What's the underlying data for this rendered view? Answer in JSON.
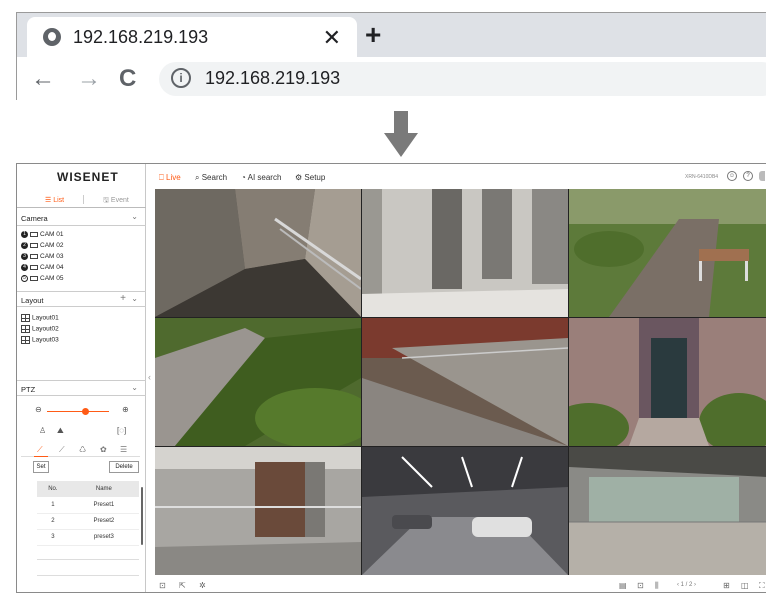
{
  "browser": {
    "tab_title": "192.168.219.193",
    "close_glyph": "✕",
    "new_tab_glyph": "+",
    "back_glyph": "←",
    "forward_glyph": "→",
    "reload_glyph": "C",
    "info_glyph": "i",
    "url": "192.168.219.193"
  },
  "app": {
    "logo": "WISENET",
    "sidebar": {
      "tab_list": "☰ List",
      "tab_event": "🖫 Event",
      "camera_header": "Camera",
      "cameras": [
        {
          "num": "1",
          "label": "CAM 01"
        },
        {
          "num": "2",
          "label": "CAM 02"
        },
        {
          "num": "3",
          "label": "CAM 03"
        },
        {
          "num": "4",
          "label": "CAM 04"
        },
        {
          "num": "5",
          "label": "CAM 05"
        }
      ],
      "layout_header": "Layout",
      "layouts": [
        "Layout01",
        "Layout02",
        "Layout03"
      ],
      "ptz_header": "PTZ",
      "set_label": "Set",
      "delete_label": "Delete",
      "preset_columns": [
        "No.",
        "Name"
      ],
      "presets": [
        {
          "no": "1",
          "name": "Preset1"
        },
        {
          "no": "2",
          "name": "Preset2"
        },
        {
          "no": "3",
          "name": "preset3"
        }
      ]
    },
    "menu": {
      "live": "Live",
      "search": "Search",
      "ai_search": "AI search",
      "setup": "Setup",
      "model": "XRN-6410DB4"
    },
    "pager": "‹ 1 / 2 ›",
    "colors": {
      "accent": "#ff5b16"
    }
  }
}
